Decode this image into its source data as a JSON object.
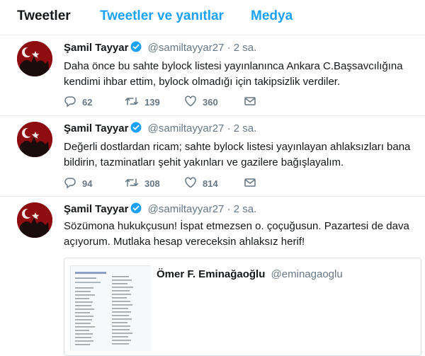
{
  "tabs": {
    "tweets": "Tweetler",
    "tweets_replies": "Tweetler ve yanıtlar",
    "media": "Medya"
  },
  "tweets": [
    {
      "name": "Şamil Tayyar",
      "handle": "@samiltayyar27",
      "dot": "·",
      "time": "2 sa.",
      "text": "Daha önce bu sahte bylock listesi yayınlanınca Ankara C.Başsavcılığına kendimi ihbar ettim, bylock olmadığı için takipsizlik verdiler.",
      "replies": "62",
      "retweets": "139",
      "likes": "360"
    },
    {
      "name": "Şamil Tayyar",
      "handle": "@samiltayyar27",
      "dot": "·",
      "time": "2 sa.",
      "text": "Değerli dostlardan ricam; sahte bylock listesi yayınlayan ahlaksızları bana bildirin, tazminatları şehit yakınları ve gazilere bağışlayalım.",
      "replies": "94",
      "retweets": "308",
      "likes": "814"
    },
    {
      "name": "Şamil Tayyar",
      "handle": "@samiltayyar27",
      "dot": "·",
      "time": "2 sa.",
      "text": "Sözümona hukukçusun! İspat etmezsen o. çoçuğusun. Pazartesi de dava açıyorum. Mutlaka hesap vereceksin ahlaksız herif!",
      "quote": {
        "name": "Ömer F. Eminağaoğlu",
        "handle": "@eminagaoglu"
      }
    }
  ],
  "colors": {
    "accent": "#1da1f2",
    "text": "#14171a",
    "muted": "#657786",
    "avatar_bg": "#8e0d11"
  },
  "icons": [
    "verified-badge-icon",
    "reply-icon",
    "retweet-icon",
    "like-icon",
    "message-icon"
  ]
}
